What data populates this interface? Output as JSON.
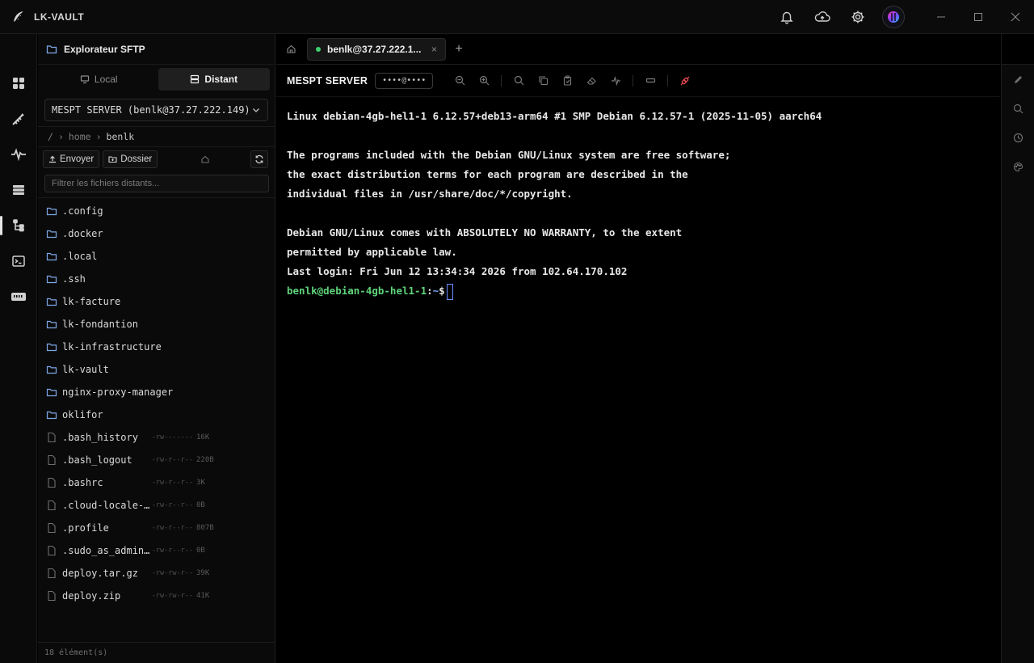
{
  "app": {
    "name": "LK-VAULT",
    "accent": "#3ecf6e",
    "background": "#000000"
  },
  "titlebar": {
    "icons": [
      "notification-bell-icon",
      "cloud-sync-icon",
      "settings-gear-icon",
      "user-avatar"
    ],
    "window_controls": [
      "minimize",
      "maximize",
      "close"
    ]
  },
  "rail": {
    "items": [
      {
        "name": "dashboard-icon",
        "active": false
      },
      {
        "name": "keys-icon",
        "active": false
      },
      {
        "name": "activity-icon",
        "active": false
      },
      {
        "name": "database-icon",
        "active": false
      },
      {
        "name": "sftp-tree-icon",
        "active": true
      },
      {
        "name": "terminal-icon",
        "active": false
      },
      {
        "name": "serial-port-icon",
        "active": false
      }
    ]
  },
  "sftp": {
    "title": "Explorateur SFTP",
    "tabs": {
      "local": "Local",
      "remote": "Distant",
      "active": "remote"
    },
    "server": "MESPT SERVER (benlk@37.27.222.149)",
    "breadcrumb": {
      "root": "/",
      "parts": [
        "home",
        "benlk"
      ]
    },
    "toolbar": {
      "upload": "Envoyer",
      "folder": "Dossier"
    },
    "filter_placeholder": "Filtrer les fichiers distants...",
    "files": [
      {
        "name": ".config",
        "type": "dir"
      },
      {
        "name": ".docker",
        "type": "dir"
      },
      {
        "name": ".local",
        "type": "dir"
      },
      {
        "name": ".ssh",
        "type": "dir"
      },
      {
        "name": "lk-facture",
        "type": "dir"
      },
      {
        "name": "lk-fondantion",
        "type": "dir"
      },
      {
        "name": "lk-infrastructure",
        "type": "dir"
      },
      {
        "name": "lk-vault",
        "type": "dir"
      },
      {
        "name": "nginx-proxy-manager",
        "type": "dir"
      },
      {
        "name": "oklifor",
        "type": "dir"
      },
      {
        "name": ".bash_history",
        "type": "file",
        "perm": "-rw-------",
        "size": "16K"
      },
      {
        "name": ".bash_logout",
        "type": "file",
        "perm": "-rw-r--r--",
        "size": "220B"
      },
      {
        "name": ".bashrc",
        "type": "file",
        "perm": "-rw-r--r--",
        "size": "3K"
      },
      {
        "name": ".cloud-locale-…",
        "type": "file",
        "perm": "-rw-r--r--",
        "size": "0B"
      },
      {
        "name": ".profile",
        "type": "file",
        "perm": "-rw-r--r--",
        "size": "807B"
      },
      {
        "name": ".sudo_as_admin…",
        "type": "file",
        "perm": "-rw-r--r--",
        "size": "0B"
      },
      {
        "name": "deploy.tar.gz",
        "type": "file",
        "perm": "-rw-rw-r--",
        "size": "39K"
      },
      {
        "name": "deploy.zip",
        "type": "file",
        "perm": "-rw-rw-r--",
        "size": "41K"
      }
    ],
    "footer": "18 élément(s)"
  },
  "main": {
    "tab": {
      "label": "benlk@37.27.222.1...",
      "close": "×",
      "status_color": "#3ecf6e"
    },
    "add_tab": "+",
    "server_name": "MESPT SERVER",
    "masked_host": "••••@••••",
    "terminal": {
      "lines": [
        "Linux debian-4gb-hel1-1 6.12.57+deb13-arm64 #1 SMP Debian 6.12.57-1 (2025-11-05) aarch64",
        "",
        "The programs included with the Debian GNU/Linux system are free software;",
        "the exact distribution terms for each program are described in the",
        "individual files in /usr/share/doc/*/copyright.",
        "",
        "Debian GNU/Linux comes with ABSOLUTELY NO WARRANTY, to the extent",
        "permitted by applicable law.",
        "Last login: Fri Jun 12 13:34:34 2026 from 102.64.170.102"
      ],
      "prompt_user": "benlk@debian-4gb-hel1-1",
      "prompt_sep": ":",
      "prompt_path": "~",
      "prompt_symbol": "$"
    }
  }
}
